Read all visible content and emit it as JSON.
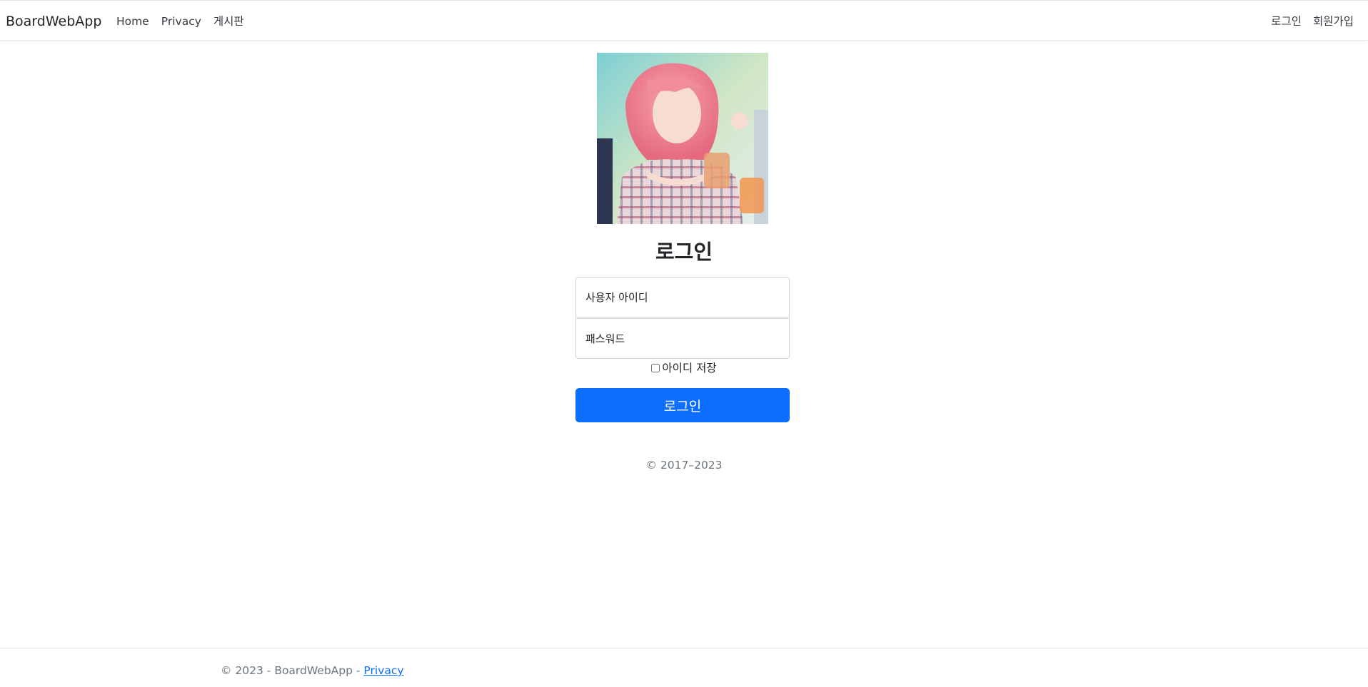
{
  "navbar": {
    "brand": "BoardWebApp",
    "left_links": [
      {
        "label": "Home"
      },
      {
        "label": "Privacy"
      },
      {
        "label": "게시판"
      }
    ],
    "right_links": [
      {
        "label": "로그인"
      },
      {
        "label": "회원가입"
      }
    ]
  },
  "login": {
    "title": "로그인",
    "user_placeholder": "사용자 아이디",
    "password_placeholder": "패스워드",
    "remember_label": "아이디 저장",
    "remember_checked": false,
    "submit_label": "로그인"
  },
  "center_copyright": "© 2017–2023",
  "footer": {
    "text": "© 2023 - BoardWebApp - ",
    "privacy_link": "Privacy"
  },
  "colors": {
    "primary": "#0d6efd",
    "muted": "#6c757d",
    "text": "#212529"
  }
}
